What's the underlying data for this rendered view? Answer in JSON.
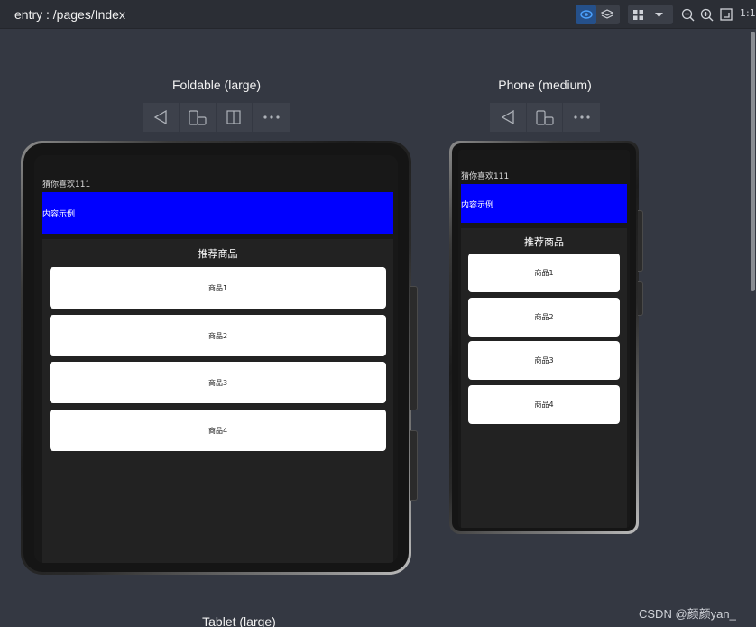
{
  "toolbar": {
    "path": "entry : /pages/Index",
    "ratio_label": "1:1",
    "icons": [
      "eye-icon",
      "layers-icon",
      "grid-icon",
      "chevron-down-icon",
      "zoom-out-icon",
      "zoom-in-icon",
      "fit-screen-icon"
    ]
  },
  "devices": [
    {
      "title": "Foldable (large)",
      "controls": [
        "back-icon",
        "rotate-icon",
        "fold-icon",
        "more-icon"
      ],
      "guess_text": "猜你喜欢111",
      "banner_text": "内容示例",
      "section_title": "推荐商品",
      "products": [
        "商品1",
        "商品2",
        "商品3",
        "商品4"
      ]
    },
    {
      "title": "Phone (medium)",
      "controls": [
        "back-icon",
        "rotate-icon",
        "more-icon"
      ],
      "guess_text": "猜你喜欢111",
      "banner_text": "内容示例",
      "section_title": "推荐商品",
      "products": [
        "商品1",
        "商品2",
        "商品3",
        "商品4"
      ]
    },
    {
      "title": "Tablet (large)"
    }
  ],
  "watermark": "CSDN @颜颜yan_",
  "colors": {
    "background": "#343842",
    "banner": "#0000ff",
    "card": "#ffffff",
    "accent": "#25508a"
  }
}
